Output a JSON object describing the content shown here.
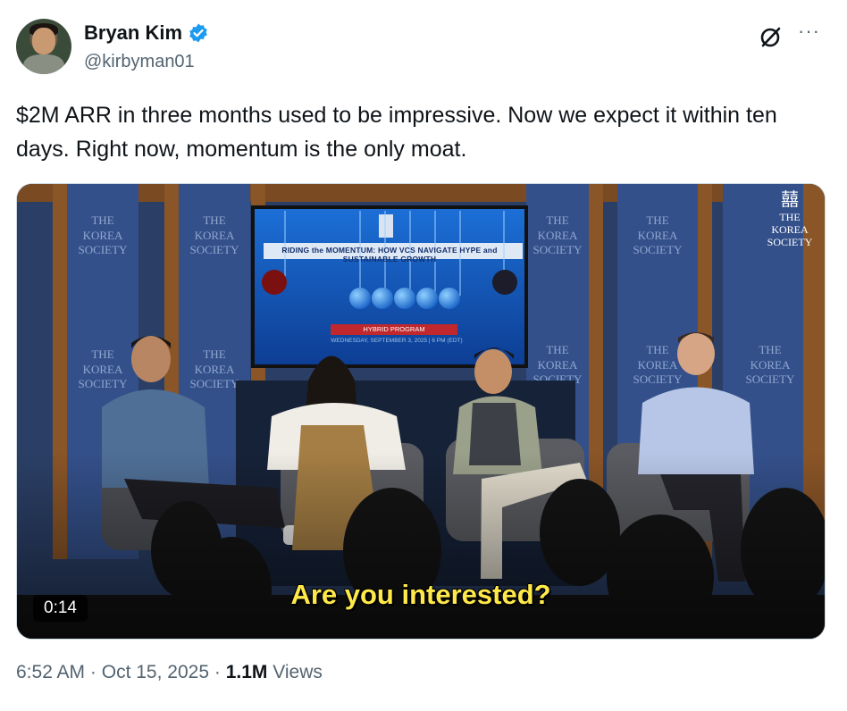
{
  "author": {
    "display_name": "Bryan Kim",
    "handle": "@kirbyman01",
    "verified": true
  },
  "tweet": {
    "text": "$2M ARR in three months used to be impressive. Now we expect it within ten days. Right now, momentum is the only moat."
  },
  "video": {
    "duration": "0:14",
    "caption": "Are you interested?",
    "slide_title": "RIDING the MOMENTUM: HOW VCS NAVIGATE HYPE and SUSTAINABLE GROWTH",
    "slide_program": "HYBRID PROGRAM",
    "slide_date": "WEDNESDAY, SEPTEMBER 3, 2025 | 6 PM (EDT)",
    "brand_mark": "囍",
    "brand_line1": "THE",
    "brand_line2": "KOREA",
    "brand_line3": "SOCIETY"
  },
  "meta": {
    "time": "6:52 AM",
    "separator": "·",
    "date": "Oct 15, 2025",
    "views_count": "1.1M",
    "views_label": "Views"
  },
  "icons": {
    "more": "more-icon",
    "grok": "grok-icon",
    "verified": "verified-badge-icon"
  },
  "colors": {
    "verified_blue": "#1d9bf0",
    "secondary_text": "#536471",
    "caption_yellow": "#ffe94a"
  }
}
